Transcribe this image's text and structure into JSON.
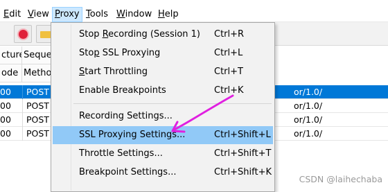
{
  "menubar": {
    "items": [
      "Edit",
      "View",
      "Proxy",
      "Tools",
      "Window",
      "Help"
    ],
    "underlines": [
      "E",
      "V",
      "P",
      "T",
      "W",
      "H"
    ],
    "active": "Proxy"
  },
  "toolbar": {
    "buttons": [
      "record-icon",
      "broom-icon"
    ]
  },
  "table": {
    "headers": [
      "cture",
      "Seque",
      "ode",
      "Metho"
    ],
    "rows": [
      {
        "code": "00",
        "method": "POST",
        "path": "or/1.0/",
        "selected": true
      },
      {
        "code": "00",
        "method": "POST",
        "path": "or/1.0/",
        "selected": false
      },
      {
        "code": "00",
        "method": "POST",
        "path": "or/1.0/",
        "selected": false
      },
      {
        "code": "00",
        "method": "POST",
        "path": "or/1.0/",
        "selected": false
      }
    ]
  },
  "proxy_menu": {
    "items": [
      {
        "pre": "Stop ",
        "ul": "R",
        "post": "ecording (Session 1)",
        "shortcut": "Ctrl+R"
      },
      {
        "pre": "Sto",
        "ul": "p",
        "post": " SSL Proxying",
        "shortcut": "Ctrl+L"
      },
      {
        "pre": "",
        "ul": "S",
        "post": "tart Throttling",
        "shortcut": "Ctrl+T"
      },
      {
        "pre": "Enable Breakpoints",
        "ul": "",
        "post": "",
        "shortcut": "Ctrl+K"
      },
      {
        "pre": "Recording Settings...",
        "ul": "",
        "post": "",
        "shortcut": ""
      },
      {
        "pre": "SSL Proxying Settings...",
        "ul": "",
        "post": "",
        "shortcut": "Ctrl+Shift+L",
        "highlighted": true
      },
      {
        "pre": "Throttle Settings...",
        "ul": "",
        "post": "",
        "shortcut": "Ctrl+Shift+T"
      },
      {
        "pre": "Breakpoint Settings...",
        "ul": "",
        "post": "",
        "shortcut": "Ctrl+Shift+K"
      }
    ]
  },
  "annotation": {
    "color": "#e020e0"
  },
  "watermark": "CSDN @laihechaba",
  "colors": {
    "selection": "#0078d7",
    "menu_highlight": "#91c9f7",
    "menubar_active": "#cce8ff"
  }
}
